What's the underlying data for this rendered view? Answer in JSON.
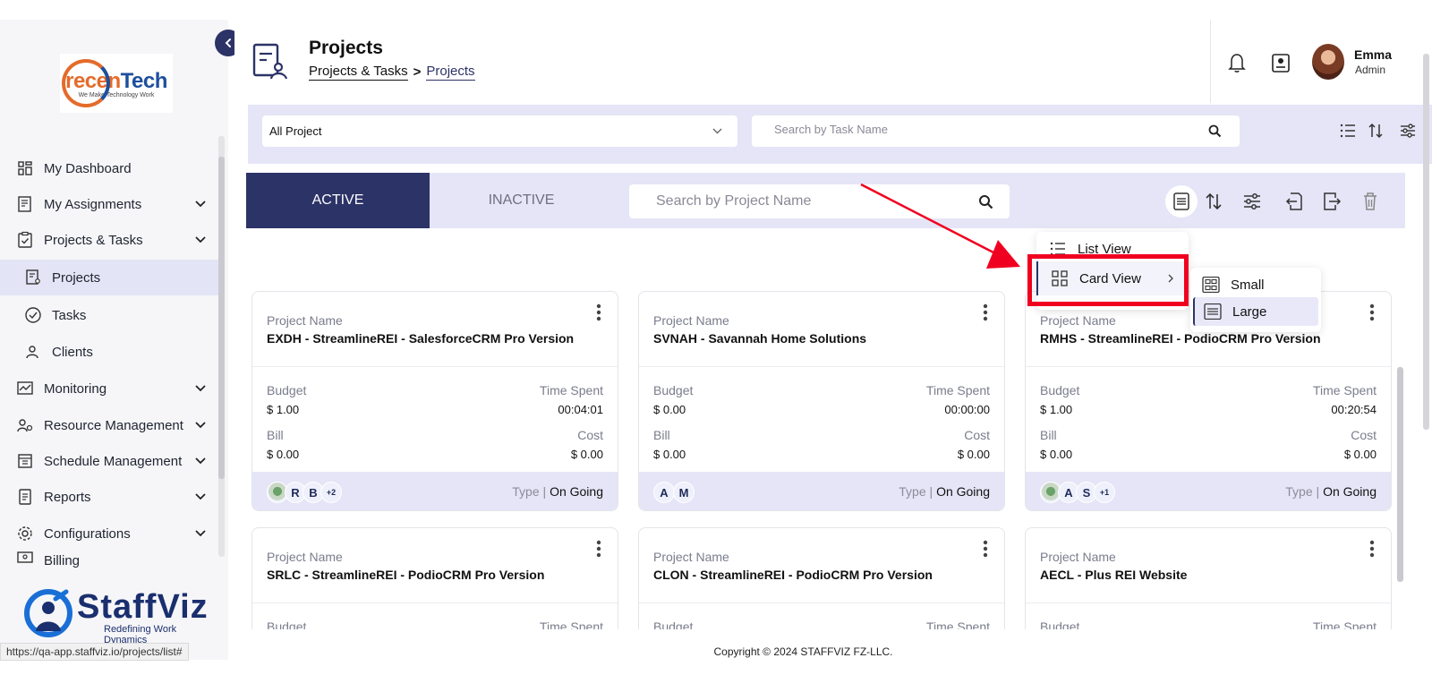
{
  "sidebar": {
    "logo": {
      "brand_prefix": "recen",
      "brand_suffix": "Tech",
      "tagline": "We Make Technology Work"
    },
    "items": [
      {
        "label": "My Dashboard",
        "icon": "dashboard-icon"
      },
      {
        "label": "My Assignments",
        "icon": "assignments-icon"
      },
      {
        "label": "Projects & Tasks",
        "icon": "clipboard-check-icon"
      },
      {
        "label": "Projects",
        "icon": "projects-icon"
      },
      {
        "label": "Tasks",
        "icon": "check-circle-icon"
      },
      {
        "label": "Clients",
        "icon": "users-icon"
      },
      {
        "label": "Monitoring",
        "icon": "monitoring-icon"
      },
      {
        "label": "Resource Management",
        "icon": "resource-icon"
      },
      {
        "label": "Schedule Management",
        "icon": "schedule-icon"
      },
      {
        "label": "Reports",
        "icon": "reports-icon"
      },
      {
        "label": "Configurations",
        "icon": "settings-icon"
      },
      {
        "label": "Billing",
        "icon": "billing-icon"
      }
    ],
    "footer_logo": {
      "name": "StaffViz",
      "tagline": "Redefining Work Dynamics"
    },
    "status_url": "https://qa-app.staffviz.io/projects/list#"
  },
  "header": {
    "title": "Projects",
    "breadcrumb": {
      "parent": "Projects & Tasks",
      "separator": ">",
      "current": "Projects"
    },
    "user": {
      "name": "Emma",
      "role": "Admin"
    }
  },
  "filters": {
    "project_select": "All Project",
    "task_search_placeholder": "Search by Task Name"
  },
  "tabs": {
    "active": "ACTIVE",
    "inactive": "INACTIVE",
    "project_search_placeholder": "Search by Project Name"
  },
  "view_menu": {
    "list_view": "List View",
    "card_view": "Card View",
    "sizes": {
      "small": "Small",
      "large": "Large"
    }
  },
  "labels": {
    "project_name": "Project Name",
    "budget": "Budget",
    "time_spent": "Time Spent",
    "bill": "Bill",
    "cost": "Cost",
    "type": "Type",
    "type_sep": "|"
  },
  "cards": [
    {
      "name": "EXDH - StreamlineREI - SalesforceCRM Pro Version",
      "budget": "$ 1.00",
      "time_spent": "00:04:01",
      "bill": "$ 0.00",
      "cost": "$ 0.00",
      "members": [
        "R",
        "B"
      ],
      "more": "+2",
      "type": "On Going"
    },
    {
      "name": "SVNAH - Savannah Home Solutions",
      "budget": "$ 0.00",
      "time_spent": "00:00:00",
      "bill": "$ 0.00",
      "cost": "$ 0.00",
      "members": [
        "A",
        "M"
      ],
      "more": "",
      "type": "On Going"
    },
    {
      "name": "RMHS - StreamlineREI - PodioCRM Pro Version",
      "budget": "$ 1.00",
      "time_spent": "00:20:54",
      "bill": "$ 0.00",
      "cost": "$ 0.00",
      "members": [
        "A",
        "S"
      ],
      "more": "+1",
      "type": "On Going"
    },
    {
      "name": "SRLC - StreamlineREI - PodioCRM Pro Version",
      "budget_label": "Budget",
      "time_label": "Time Spent"
    },
    {
      "name": "CLON - StreamlineREI - PodioCRM Pro Version",
      "budget_label": "Budget",
      "time_label": "Time Spent"
    },
    {
      "name": "AECL - Plus REI Website",
      "budget_label": "Budget",
      "time_label": "Time Spent"
    }
  ],
  "copyright": "Copyright © 2024 STAFFVIZ FZ-LLC.",
  "colors": {
    "primary": "#2c3367",
    "tint": "#e5e5f7",
    "annotation": "#f00020"
  }
}
